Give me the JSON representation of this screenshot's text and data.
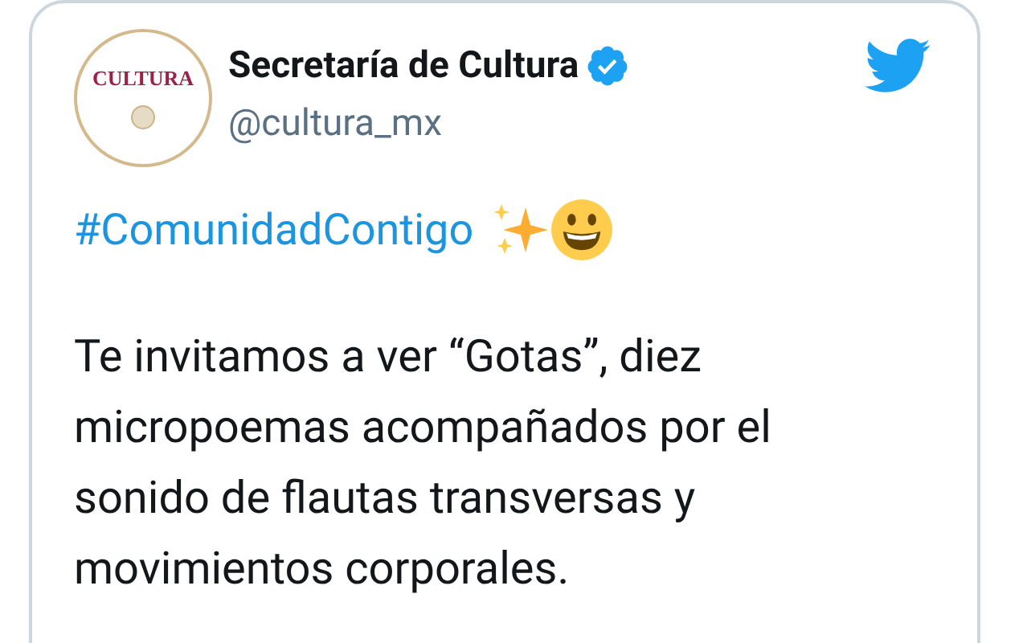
{
  "author": {
    "avatar_text": "CULTURA",
    "name": "Secretaría de Cultura",
    "verified": true,
    "handle": "@cultura_mx"
  },
  "tweet": {
    "hashtag": "#ComunidadContigo",
    "text": "Te invitamos a ver “Gotas”, diez micropoemas acompañados por el sonido de flautas transversas y movimientos corporales."
  }
}
